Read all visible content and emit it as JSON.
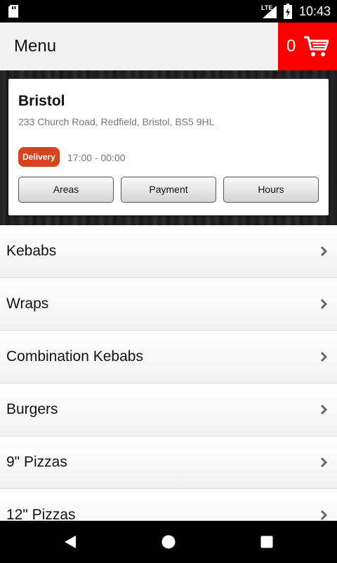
{
  "status_bar": {
    "network": "LTE",
    "time": "10:43"
  },
  "app_bar": {
    "title": "Menu",
    "cart_count": "0"
  },
  "shop": {
    "name": "Bristol",
    "address": "233 Church Road, Redfield, Bristol, BS5 9HL",
    "badge": "Delivery",
    "hours": "17:00 - 00:00",
    "buttons": {
      "areas": "Areas",
      "payment": "Payment",
      "hours": "Hours"
    }
  },
  "menu": {
    "categories": [
      {
        "label": "Kebabs"
      },
      {
        "label": "Wraps"
      },
      {
        "label": "Combination Kebabs"
      },
      {
        "label": "Burgers"
      },
      {
        "label": "9\" Pizzas"
      },
      {
        "label": "12\" Pizzas"
      }
    ]
  },
  "colors": {
    "accent": "#ff0000",
    "badge": "#d8421c"
  },
  "icons": [
    "sd-card-icon",
    "signal-icon",
    "battery-icon",
    "cart-icon",
    "chevron-right-icon",
    "back-icon",
    "home-icon",
    "recents-icon"
  ]
}
